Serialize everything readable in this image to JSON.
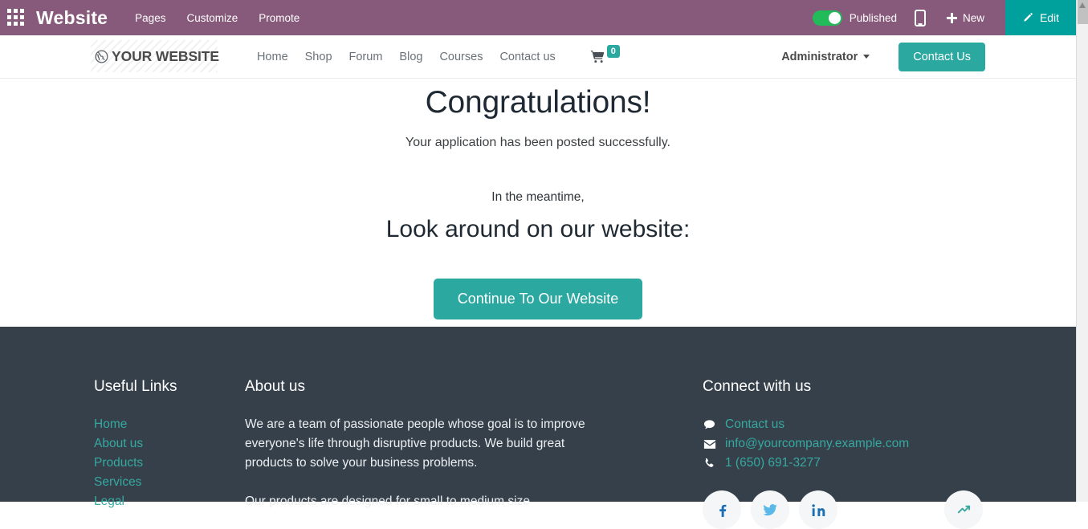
{
  "editor_bar": {
    "apps_icon": "apps-grid-icon",
    "app_title": "Website",
    "menu": [
      {
        "label": "Pages"
      },
      {
        "label": "Customize"
      },
      {
        "label": "Promote"
      }
    ],
    "publish_label": "Published",
    "publish_state": "on",
    "mobile_preview_icon": "mobile-icon",
    "new_label": "New",
    "new_icon": "plus-icon",
    "edit_label": "Edit",
    "edit_icon": "pencil-icon",
    "bar_color": "#875A7B",
    "edit_button_color": "#00A09D",
    "toggle_color": "#21BB5A"
  },
  "site_header": {
    "logo_icon": "globe-icon",
    "logo_text": "YOUR WEBSITE",
    "nav": [
      {
        "label": "Home"
      },
      {
        "label": "Shop"
      },
      {
        "label": "Forum"
      },
      {
        "label": "Blog"
      },
      {
        "label": "Courses"
      },
      {
        "label": "Contact us"
      }
    ],
    "cart_icon": "shopping-cart-icon",
    "cart_count": "0",
    "user_menu_label": "Administrator",
    "cta_label": "Contact Us",
    "accent_color": "#2BA8A0"
  },
  "main": {
    "heading": "Congratulations!",
    "subheading": "Your application has been posted successfully.",
    "meantime": "In the meantime,",
    "look_around": "Look around on our website:",
    "continue_label": "Continue To Our Website"
  },
  "footer": {
    "background_color": "#36404A",
    "link_color": "#35A8A0",
    "useful_links": {
      "title": "Useful Links",
      "items": [
        {
          "label": "Home"
        },
        {
          "label": "About us"
        },
        {
          "label": "Products"
        },
        {
          "label": "Services"
        },
        {
          "label": "Legal"
        }
      ]
    },
    "about": {
      "title": "About us",
      "paragraph_1": "We are a team of passionate people whose goal is to improve everyone's life through disruptive products. We build great products to solve your business problems.",
      "paragraph_2": "Our products are designed for small to medium size"
    },
    "connect": {
      "title": "Connect with us",
      "contact_label": "Contact us",
      "contact_icon": "comment-icon",
      "email": "info@yourcompany.example.com",
      "email_icon": "envelope-icon",
      "phone": "1 (650) 691-3277",
      "phone_icon": "phone-icon",
      "socials": [
        {
          "name": "facebook-icon"
        },
        {
          "name": "twitter-icon"
        },
        {
          "name": "linkedin-icon"
        },
        {
          "name": "share-icon"
        }
      ]
    }
  },
  "scrollbar": {
    "position": "top"
  }
}
